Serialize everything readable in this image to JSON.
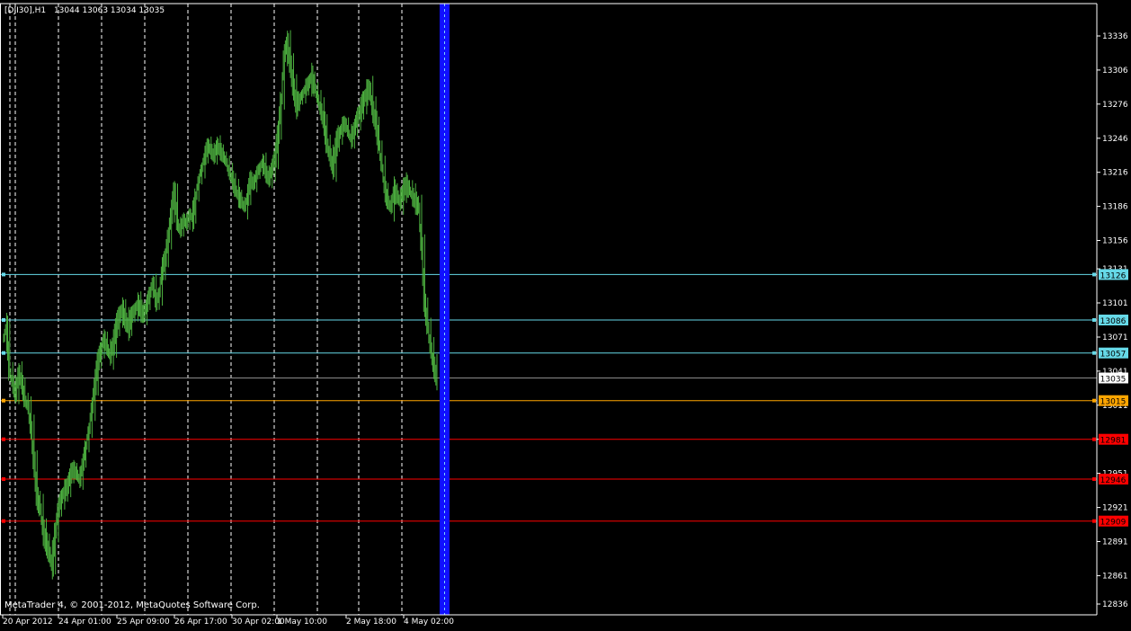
{
  "header": {
    "symbol": "[DJI30],H1",
    "ohlc": "13044 13063 13034 13035"
  },
  "copyright": "MetaTrader 4, © 2001-2012, MetaQuotes Software Corp.",
  "colors": {
    "background": "#000000",
    "candle": "#4caf3f",
    "axis": "#ffffff",
    "session_separator": "#ffffff",
    "current_bar_marker": "#1010ff",
    "resistance_line": "#66d9e8",
    "pivot_line": "#ffa500",
    "support_line": "#ff0000"
  },
  "chart_data": {
    "type": "candlestick",
    "timeframe": "H1",
    "ylim": [
      12825,
      13350
    ],
    "y_ticks": [
      13336,
      13306,
      13276,
      13246,
      13216,
      13186,
      13156,
      13131,
      13101,
      13071,
      13041,
      13011,
      12981,
      12951,
      12921,
      12891,
      12861,
      12836
    ],
    "x_ticks": [
      "20 Apr 2012",
      "24 Apr 01:00",
      "25 Apr 09:00",
      "26 Apr 17:00",
      "30 Apr 02:00",
      "1 May 10:00",
      "2 May 18:00",
      "4 May 02:00"
    ],
    "current_price": 13035,
    "levels": [
      {
        "value": 13126,
        "label": "13126",
        "kind": "resistance"
      },
      {
        "value": 13086,
        "label": "13086",
        "kind": "resistance"
      },
      {
        "value": 13057,
        "label": "13057",
        "kind": "resistance"
      },
      {
        "value": 13015,
        "label": "13015",
        "kind": "pivot"
      },
      {
        "value": 12981,
        "label": "12981",
        "kind": "support"
      },
      {
        "value": 12946,
        "label": "12946",
        "kind": "support"
      },
      {
        "value": 12909,
        "label": "12909",
        "kind": "support"
      }
    ],
    "price_path": [
      13070,
      13080,
      13040,
      13030,
      13020,
      13040,
      13030,
      13015,
      13010,
      12990,
      12960,
      12930,
      12920,
      12900,
      12890,
      12880,
      12870,
      12900,
      12920,
      12930,
      12935,
      12940,
      12950,
      12955,
      12950,
      12945,
      12960,
      12975,
      12990,
      13010,
      13030,
      13050,
      13060,
      13070,
      13060,
      13055,
      13065,
      13080,
      13090,
      13095,
      13085,
      13080,
      13090,
      13095,
      13100,
      13095,
      13090,
      13100,
      13110,
      13120,
      13100,
      13110,
      13130,
      13140,
      13160,
      13180,
      13200,
      13170,
      13165,
      13175,
      13170,
      13180,
      13175,
      13195,
      13210,
      13220,
      13230,
      13240,
      13235,
      13230,
      13240,
      13235,
      13230,
      13225,
      13215,
      13210,
      13200,
      13195,
      13190,
      13185,
      13195,
      13210,
      13205,
      13215,
      13220,
      13225,
      13215,
      13210,
      13220,
      13230,
      13250,
      13280,
      13320,
      13330,
      13310,
      13290,
      13275,
      13280,
      13285,
      13290,
      13295,
      13300,
      13290,
      13280,
      13270,
      13260,
      13240,
      13230,
      13220,
      13240,
      13250,
      13255,
      13260,
      13250,
      13245,
      13255,
      13265,
      13270,
      13280,
      13285,
      13290,
      13270,
      13260,
      13240,
      13220,
      13200,
      13190,
      13185,
      13200,
      13195,
      13190,
      13200,
      13205,
      13200,
      13195,
      13190,
      13185,
      13150,
      13100,
      13080,
      13060,
      13045,
      13035
    ]
  }
}
